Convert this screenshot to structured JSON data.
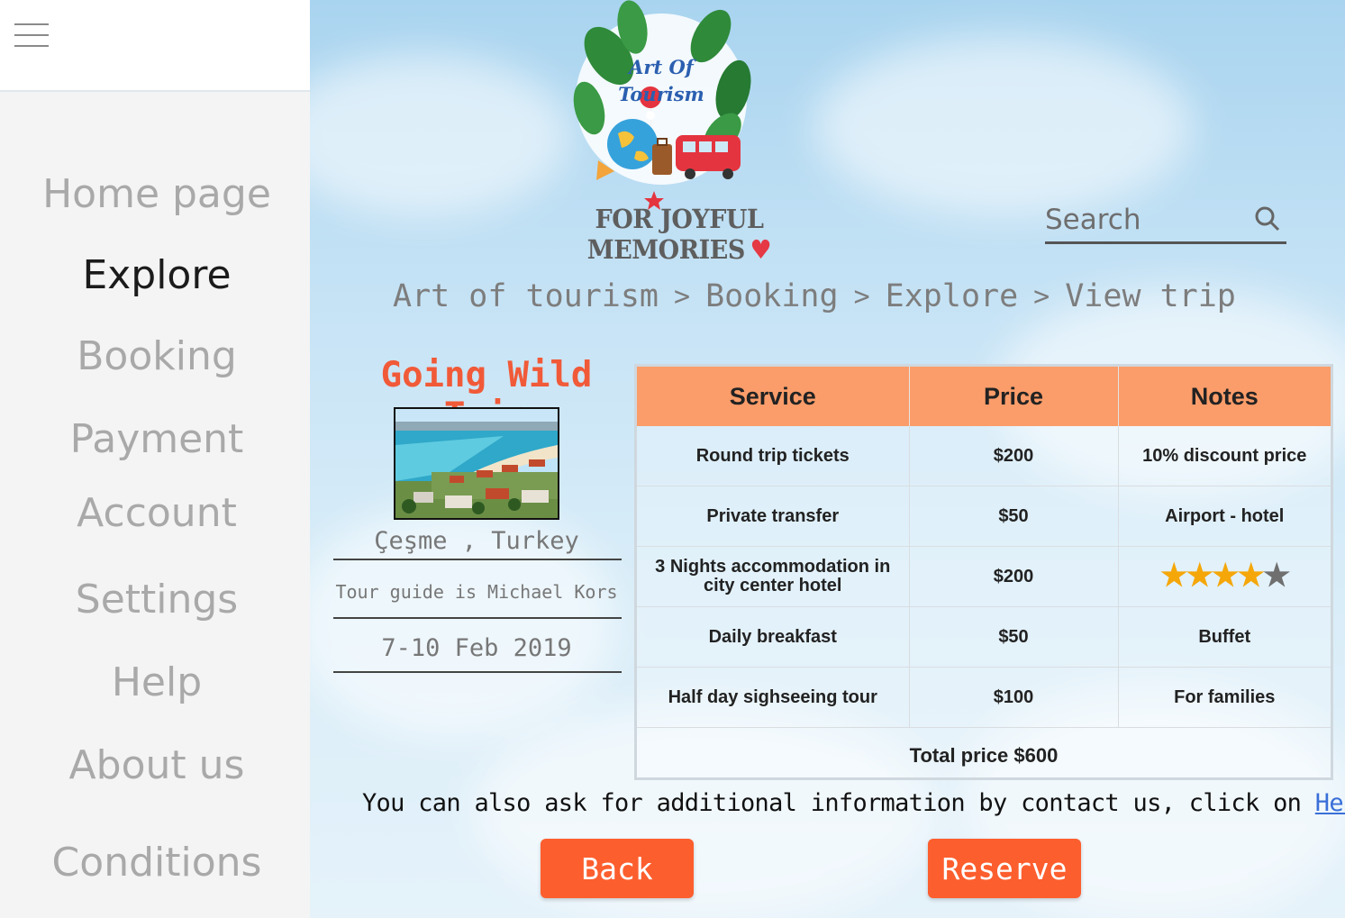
{
  "menu": {
    "icon": "hamburger-menu-icon",
    "items": [
      {
        "label": "Home page",
        "active": false
      },
      {
        "label": "Explore",
        "active": true
      },
      {
        "label": "Booking",
        "active": false
      },
      {
        "label": "Payment",
        "active": false
      },
      {
        "label": "Account",
        "active": false
      },
      {
        "label": "Settings",
        "active": false
      },
      {
        "label": "Help",
        "active": false
      },
      {
        "label": "About us",
        "active": false
      },
      {
        "label": "Conditions",
        "active": false
      }
    ]
  },
  "logo": {
    "line1": "Art Of",
    "line2": "Tourism",
    "tagline": "FOR JOYFUL MEMORIES",
    "heart": "♥"
  },
  "search": {
    "placeholder": "Search",
    "icon": "search-icon"
  },
  "breadcrumb": [
    "Art of tourism",
    "Booking",
    "Explore",
    "View trip"
  ],
  "breadcrumb_separator": ">",
  "trip": {
    "title": "Going Wild Trip",
    "location": "Çeşme , Turkey",
    "guide": "Tour guide is Michael Kors",
    "dates": "7-10 Feb 2019"
  },
  "table": {
    "headers": [
      "Service",
      "Price",
      "Notes"
    ],
    "rows": [
      {
        "service": "Round trip tickets",
        "price": "$200",
        "notes": "10% discount price"
      },
      {
        "service": "Private transfer",
        "price": "$50",
        "notes": "Airport - hotel"
      },
      {
        "service": "3 Nights accommodation in city center hotel",
        "price": "$200",
        "notes": "",
        "stars": 4,
        "stars_max": 5
      },
      {
        "service": "Daily breakfast",
        "price": "$50",
        "notes": "Buffet"
      },
      {
        "service": "Half day sighseeing tour",
        "price": "$100",
        "notes": "For families"
      }
    ],
    "total": "Total price $600"
  },
  "info": {
    "text": "You can also ask for additional information by contact us, click on ",
    "link": "Help",
    "suffix": " ."
  },
  "buttons": {
    "back": "Back",
    "reserve": "Reserve"
  },
  "colors": {
    "accent": "#fd5e2e",
    "header": "#fb9d6a",
    "title": "#f15a38",
    "star": "#f5a70a"
  }
}
